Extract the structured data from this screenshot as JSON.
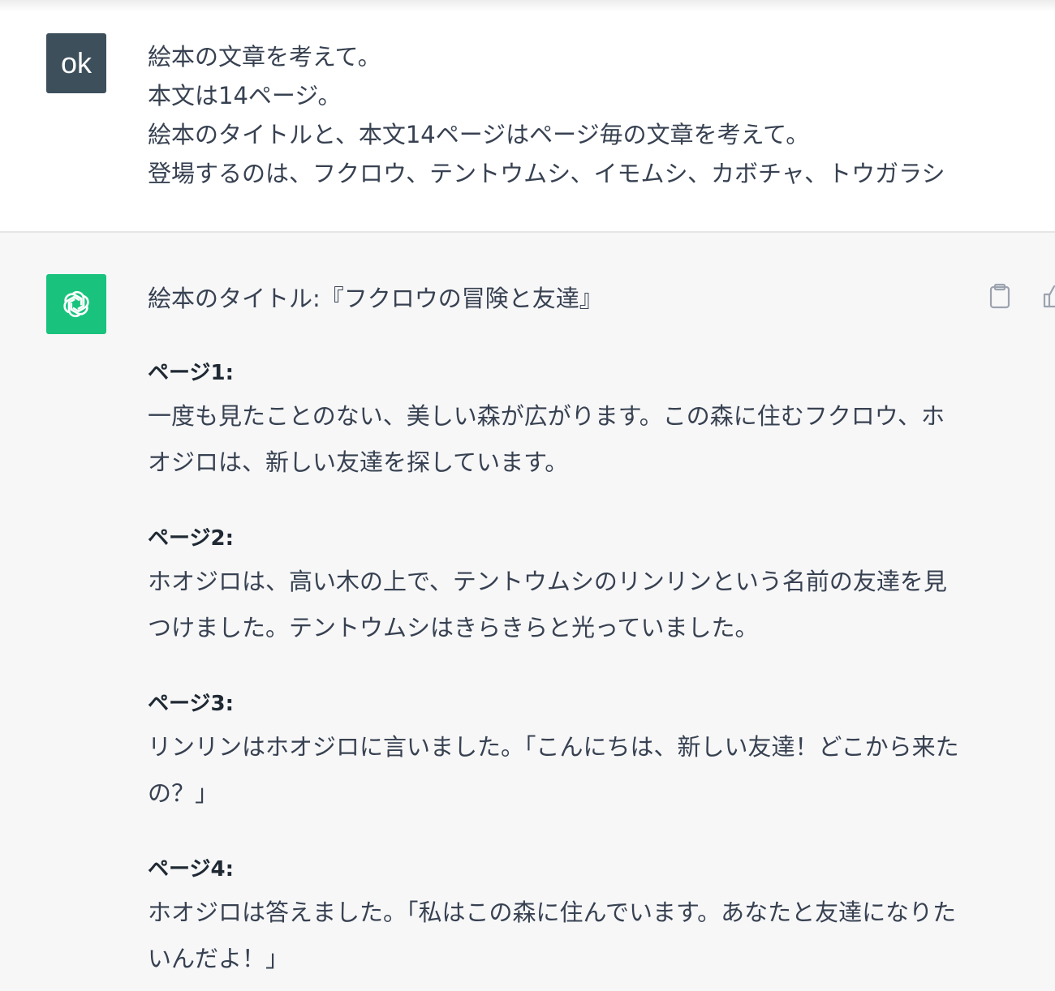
{
  "user_message": {
    "avatar_text": "ok",
    "lines": [
      "絵本の文章を考えて。",
      "本文は14ページ。",
      "絵本のタイトルと、本文14ページはページ毎の文章を考えて。",
      "登場するのは、フクロウ、テントウムシ、イモムシ、カボチャ、トウガラシ"
    ]
  },
  "assistant_message": {
    "avatar_icon": "openai-logo-icon",
    "title": "絵本のタイトル:『フクロウの冒険と友達』",
    "pages": [
      {
        "heading": "ページ1:",
        "body": "一度も見たことのない、美しい森が広がります。この森に住むフクロウ、ホオジロは、新しい友達を探しています。"
      },
      {
        "heading": "ページ2:",
        "body": "ホオジロは、高い木の上で、テントウムシのリンリンという名前の友達を見つけました。テントウムシはきらきらと光っていました。"
      },
      {
        "heading": "ページ3:",
        "body": "リンリンはホオジロに言いました。「こんにちは、新しい友達！どこから来たの？」"
      },
      {
        "heading": "ページ4:",
        "body": "ホオジロは答えました。「私はこの森に住んでいます。あなたと友達になりたいんだよ！」"
      }
    ],
    "actions": {
      "copy_icon": "clipboard-icon",
      "like_icon": "thumbs-up-icon"
    }
  },
  "colors": {
    "user_bg": "#ffffff",
    "assistant_bg": "#f7f7f8",
    "user_avatar_bg": "#3d4f5b",
    "assistant_avatar_bg": "#19c37d",
    "text": "#374151"
  }
}
